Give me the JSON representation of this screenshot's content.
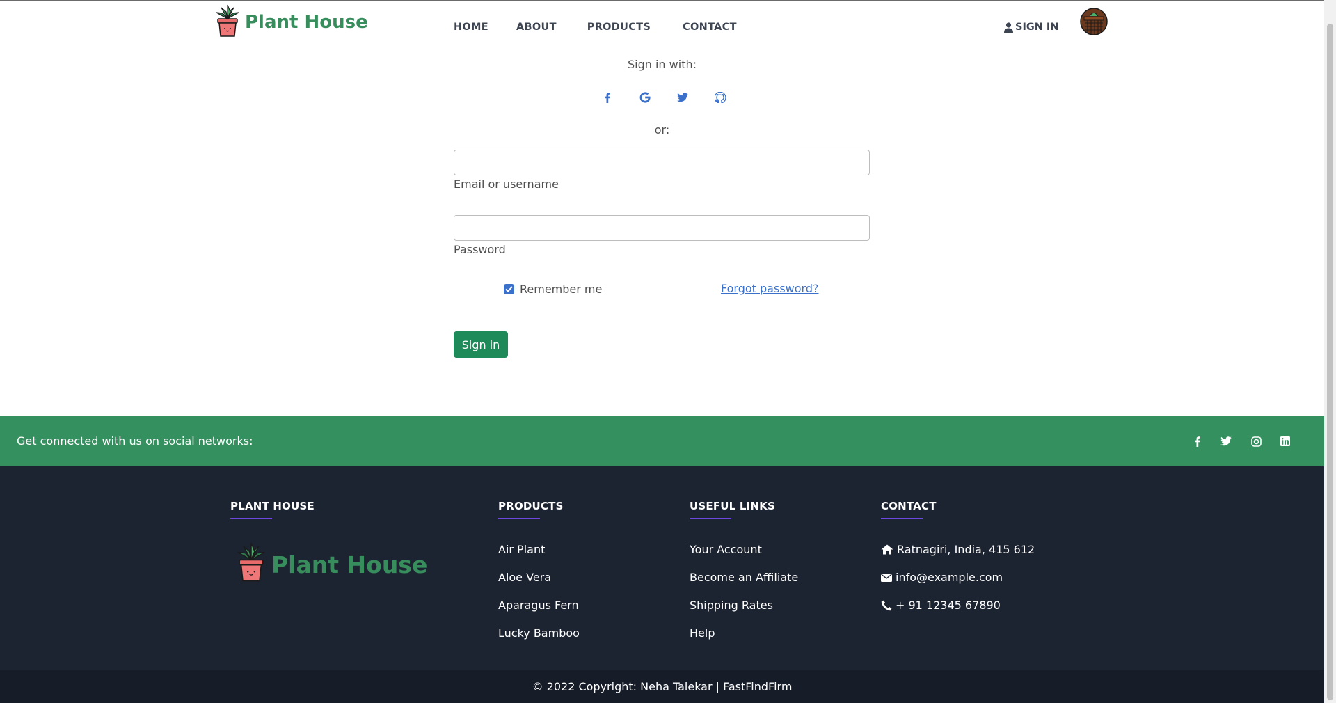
{
  "navbar": {
    "brand": "Plant House",
    "links": [
      "HOME",
      "ABOUT",
      "PRODUCTS",
      "CONTACT"
    ],
    "signin": "SIGN IN"
  },
  "signin_form": {
    "signin_with": "Sign in with:",
    "social_icons": [
      "facebook-icon",
      "google-icon",
      "twitter-icon",
      "github-icon"
    ],
    "or": "or:",
    "email_label": "Email or username",
    "email_value": "",
    "password_label": "Password",
    "password_value": "",
    "remember_me": "Remember me",
    "remember_checked": true,
    "forgot": "Forgot password?",
    "submit": "Sign in"
  },
  "social_bar": {
    "text": "Get connected with us on social networks:",
    "icons": [
      "facebook-icon",
      "twitter-icon",
      "instagram-icon",
      "linkedin-icon"
    ]
  },
  "footer": {
    "col_brand": {
      "heading": "PLANT HOUSE",
      "logo_text": "Plant House"
    },
    "col_products": {
      "heading": "PRODUCTS",
      "items": [
        "Air Plant",
        "Aloe Vera",
        "Aparagus Fern",
        "Lucky Bamboo"
      ]
    },
    "col_links": {
      "heading": "USEFUL LINKS",
      "items": [
        "Your Account",
        "Become an Affiliate",
        "Shipping Rates",
        "Help"
      ]
    },
    "col_contact": {
      "heading": "CONTACT",
      "address": "Ratnagiri, India, 415 612",
      "email": "info@example.com",
      "phone": "+ 91 12345 67890"
    },
    "copyright": "© 2022 Copyright: Neha Talekar | FastFindFirm"
  },
  "colors": {
    "brand_green": "#378d5c",
    "social_bar": "#35905f",
    "footer_bg": "#1c2331",
    "button": "#1e8a5a",
    "link_blue": "#3b71ca"
  }
}
